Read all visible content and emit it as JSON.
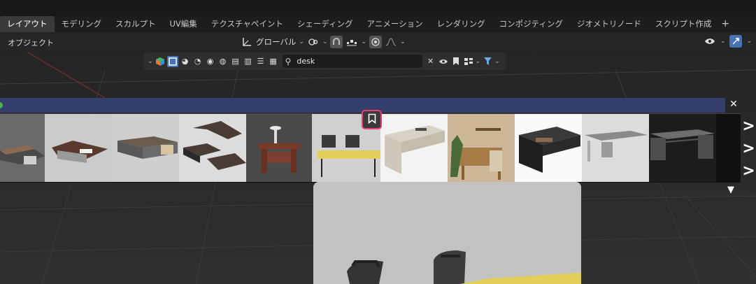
{
  "tabs": [
    {
      "label": "レイアウト",
      "active": true
    },
    {
      "label": "モデリング"
    },
    {
      "label": "スカルプト"
    },
    {
      "label": "UV編集"
    },
    {
      "label": "テクスチャペイント"
    },
    {
      "label": "シェーディング"
    },
    {
      "label": "アニメーション"
    },
    {
      "label": "レンダリング"
    },
    {
      "label": "コンポジティング"
    },
    {
      "label": "ジオメトリノード"
    },
    {
      "label": "スクリプト作成"
    },
    {
      "label": "+"
    }
  ],
  "header": {
    "mode_label": "オブジェクト",
    "orientation_label": "グローバル"
  },
  "search": {
    "value": "desk",
    "clear_icon": "close-icon",
    "visibility_icon": "eye-icon",
    "bookmark_icon": "bookmark-icon",
    "filter_icon": "funnel-icon"
  },
  "gallery": {
    "items": [
      "desk-1",
      "desk-2",
      "desk-3",
      "desk-4",
      "desk-5",
      "desk-6",
      "desk-7",
      "desk-8",
      "desk-9",
      "desk-10"
    ],
    "nav_icon": "chevron-right-icon",
    "expand_icon": "triangle-down-icon",
    "close_icon": "close-icon",
    "highlight_icon": "bookmark-icon"
  },
  "colors": {
    "accent_blue": "#4772b3",
    "banner": "#34406b",
    "highlight": "#ea3d7a"
  }
}
